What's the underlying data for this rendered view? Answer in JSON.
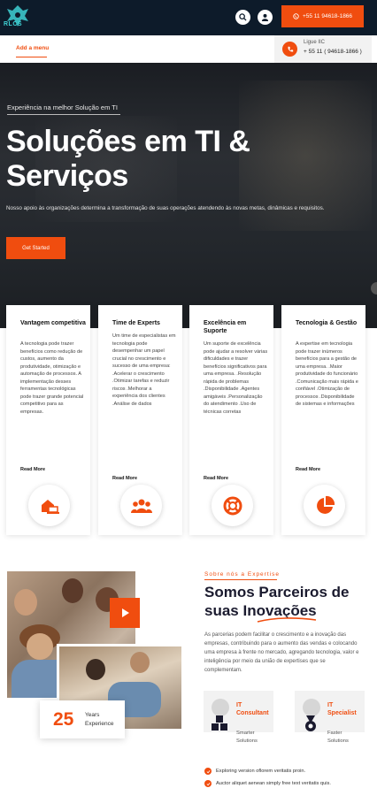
{
  "header": {
    "logo_text": "RLCS",
    "phone_button_label": "+55 11 94618-1866",
    "icons": [
      "search-icon",
      "user-icon",
      "whatsapp-icon"
    ]
  },
  "nav": {
    "add_menu_label": "Add a menu",
    "call_label": "Ligue IIC",
    "call_number": "+ 55 11 ( 94618-1866 )"
  },
  "hero": {
    "tagline": "Experiência na melhor Solução em TI",
    "title": "Soluções em TI & Serviços",
    "description": "Nosso apoio às organizações determina a transformação de suas operações atendendo às novas metas, dinâmicas e requisitos.",
    "cta_label": "Get Started"
  },
  "features": [
    {
      "title": "Vantagem competitiva",
      "text": "A tecnologia pode trazer benefícios como redução de custos, aumento da produtividade, otimização e automação de processos. A implementação desses ferramentas tecnológicas pode trazer grande potencial competitivo para as empresas.",
      "more": "Read More",
      "icon": "laptop-home-icon"
    },
    {
      "title": "Time de Experts",
      "text": "Um time de especialistas em tecnologia pode desempenhar um papel crucial no crescimento e sucesso de uma empresa: .Acelerar o crescimento .Otimizar tarefas e reduzir riscos .Melhorar a experiência dos clientes .Análise de dados",
      "more": "Read More",
      "icon": "team-icon"
    },
    {
      "title": "Excelência em Suporte",
      "text": "Um suporte de excelência pode ajudar a resolver várias dificuldades e trazer benefícios significativos para uma empresa. .Resolução rápida de problemas .Disponibilidade .Agentes amigáveis .Personalização do atendimento .Uso de técnicas corretas",
      "more": "Read More",
      "icon": "lifebuoy-icon"
    },
    {
      "title": "Tecnologia & Gestão",
      "text": "A expertise em tecnologia pode trazer inúmeros benefícios para a gestão de uma empresa. .Maior produtividade do funcionário .Comunicação mais rápida e confiável .Otimização de processos .Disponibilidade de sistemas e informações",
      "more": "Read More",
      "icon": "pie-chart-icon"
    }
  ],
  "about": {
    "tag": "Sobre nós a Expertise",
    "title": "Somos Parceiros de suas Inovações",
    "description": "As parcerias podem facilitar o crescimento e a inovação das empresas, contribuindo para o aumento das vendas e colocando uma empresa à frente no mercado, agregando tecnologia, valor e inteligência por meio da união de expertises que se complementam.",
    "years_number": "25",
    "years_label": "Years Experience",
    "services": [
      {
        "title": "IT Consultant",
        "subtitle": "Smarter Solutions",
        "icon": "cubes-icon"
      },
      {
        "title": "IT Specialist",
        "subtitle": "Faster Solutions",
        "icon": "medal-icon"
      }
    ],
    "checklist": [
      "Exploring version oflorem veritatis proin.",
      "Auctor aliquet aenean simply free text veritatis quis."
    ]
  },
  "colors": {
    "accent": "#f04d0f",
    "dark": "#0d1b2a"
  }
}
